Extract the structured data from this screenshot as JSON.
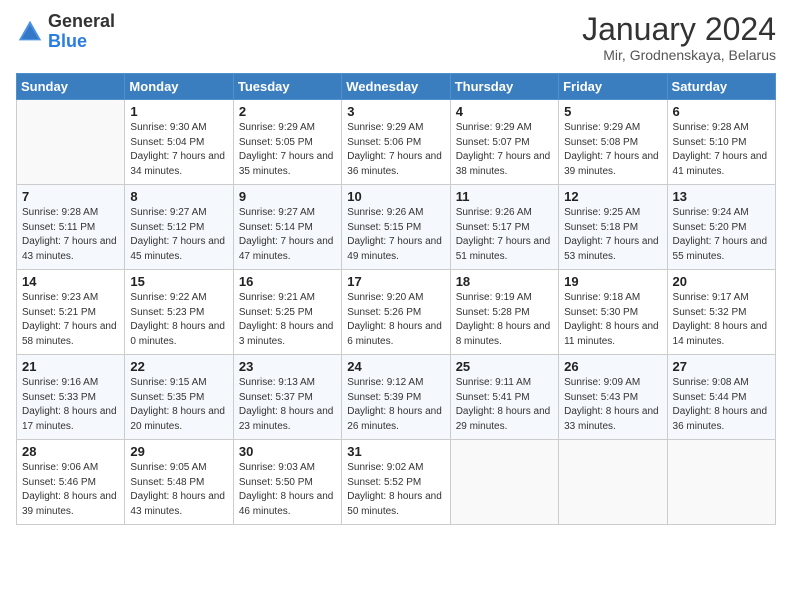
{
  "header": {
    "logo_general": "General",
    "logo_blue": "Blue",
    "title": "January 2024",
    "location": "Mir, Grodnenskaya, Belarus"
  },
  "days_of_week": [
    "Sunday",
    "Monday",
    "Tuesday",
    "Wednesday",
    "Thursday",
    "Friday",
    "Saturday"
  ],
  "weeks": [
    [
      {
        "day": "",
        "content": ""
      },
      {
        "day": "1",
        "content": "Sunrise: 9:30 AM\nSunset: 5:04 PM\nDaylight: 7 hours\nand 34 minutes."
      },
      {
        "day": "2",
        "content": "Sunrise: 9:29 AM\nSunset: 5:05 PM\nDaylight: 7 hours\nand 35 minutes."
      },
      {
        "day": "3",
        "content": "Sunrise: 9:29 AM\nSunset: 5:06 PM\nDaylight: 7 hours\nand 36 minutes."
      },
      {
        "day": "4",
        "content": "Sunrise: 9:29 AM\nSunset: 5:07 PM\nDaylight: 7 hours\nand 38 minutes."
      },
      {
        "day": "5",
        "content": "Sunrise: 9:29 AM\nSunset: 5:08 PM\nDaylight: 7 hours\nand 39 minutes."
      },
      {
        "day": "6",
        "content": "Sunrise: 9:28 AM\nSunset: 5:10 PM\nDaylight: 7 hours\nand 41 minutes."
      }
    ],
    [
      {
        "day": "7",
        "content": "Sunrise: 9:28 AM\nSunset: 5:11 PM\nDaylight: 7 hours\nand 43 minutes."
      },
      {
        "day": "8",
        "content": "Sunrise: 9:27 AM\nSunset: 5:12 PM\nDaylight: 7 hours\nand 45 minutes."
      },
      {
        "day": "9",
        "content": "Sunrise: 9:27 AM\nSunset: 5:14 PM\nDaylight: 7 hours\nand 47 minutes."
      },
      {
        "day": "10",
        "content": "Sunrise: 9:26 AM\nSunset: 5:15 PM\nDaylight: 7 hours\nand 49 minutes."
      },
      {
        "day": "11",
        "content": "Sunrise: 9:26 AM\nSunset: 5:17 PM\nDaylight: 7 hours\nand 51 minutes."
      },
      {
        "day": "12",
        "content": "Sunrise: 9:25 AM\nSunset: 5:18 PM\nDaylight: 7 hours\nand 53 minutes."
      },
      {
        "day": "13",
        "content": "Sunrise: 9:24 AM\nSunset: 5:20 PM\nDaylight: 7 hours\nand 55 minutes."
      }
    ],
    [
      {
        "day": "14",
        "content": "Sunrise: 9:23 AM\nSunset: 5:21 PM\nDaylight: 7 hours\nand 58 minutes."
      },
      {
        "day": "15",
        "content": "Sunrise: 9:22 AM\nSunset: 5:23 PM\nDaylight: 8 hours\nand 0 minutes."
      },
      {
        "day": "16",
        "content": "Sunrise: 9:21 AM\nSunset: 5:25 PM\nDaylight: 8 hours\nand 3 minutes."
      },
      {
        "day": "17",
        "content": "Sunrise: 9:20 AM\nSunset: 5:26 PM\nDaylight: 8 hours\nand 6 minutes."
      },
      {
        "day": "18",
        "content": "Sunrise: 9:19 AM\nSunset: 5:28 PM\nDaylight: 8 hours\nand 8 minutes."
      },
      {
        "day": "19",
        "content": "Sunrise: 9:18 AM\nSunset: 5:30 PM\nDaylight: 8 hours\nand 11 minutes."
      },
      {
        "day": "20",
        "content": "Sunrise: 9:17 AM\nSunset: 5:32 PM\nDaylight: 8 hours\nand 14 minutes."
      }
    ],
    [
      {
        "day": "21",
        "content": "Sunrise: 9:16 AM\nSunset: 5:33 PM\nDaylight: 8 hours\nand 17 minutes."
      },
      {
        "day": "22",
        "content": "Sunrise: 9:15 AM\nSunset: 5:35 PM\nDaylight: 8 hours\nand 20 minutes."
      },
      {
        "day": "23",
        "content": "Sunrise: 9:13 AM\nSunset: 5:37 PM\nDaylight: 8 hours\nand 23 minutes."
      },
      {
        "day": "24",
        "content": "Sunrise: 9:12 AM\nSunset: 5:39 PM\nDaylight: 8 hours\nand 26 minutes."
      },
      {
        "day": "25",
        "content": "Sunrise: 9:11 AM\nSunset: 5:41 PM\nDaylight: 8 hours\nand 29 minutes."
      },
      {
        "day": "26",
        "content": "Sunrise: 9:09 AM\nSunset: 5:43 PM\nDaylight: 8 hours\nand 33 minutes."
      },
      {
        "day": "27",
        "content": "Sunrise: 9:08 AM\nSunset: 5:44 PM\nDaylight: 8 hours\nand 36 minutes."
      }
    ],
    [
      {
        "day": "28",
        "content": "Sunrise: 9:06 AM\nSunset: 5:46 PM\nDaylight: 8 hours\nand 39 minutes."
      },
      {
        "day": "29",
        "content": "Sunrise: 9:05 AM\nSunset: 5:48 PM\nDaylight: 8 hours\nand 43 minutes."
      },
      {
        "day": "30",
        "content": "Sunrise: 9:03 AM\nSunset: 5:50 PM\nDaylight: 8 hours\nand 46 minutes."
      },
      {
        "day": "31",
        "content": "Sunrise: 9:02 AM\nSunset: 5:52 PM\nDaylight: 8 hours\nand 50 minutes."
      },
      {
        "day": "",
        "content": ""
      },
      {
        "day": "",
        "content": ""
      },
      {
        "day": "",
        "content": ""
      }
    ]
  ]
}
